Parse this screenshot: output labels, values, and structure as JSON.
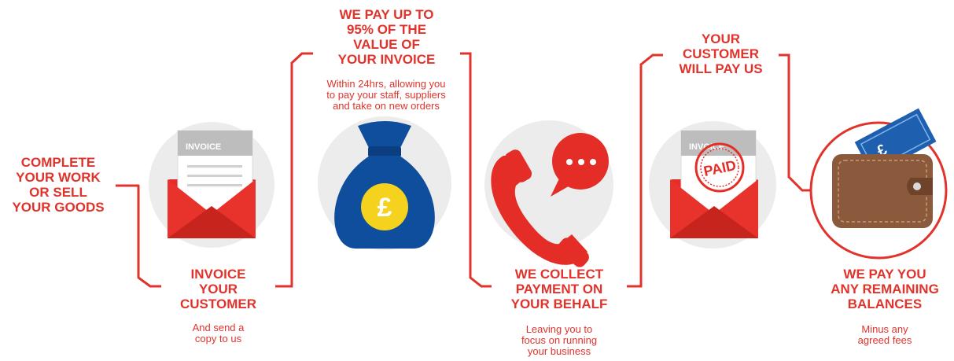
{
  "colors": {
    "brand_red": "#e0332c",
    "circle_grey": "#ececec",
    "bag_blue": "#0f4e9c",
    "coin_yellow": "#f5d21e",
    "wallet_brown": "#8b5a3c",
    "note_blue": "#1f5fb0"
  },
  "steps": [
    {
      "id": "complete-work",
      "heading": [
        "COMPLETE",
        "YOUR WORK",
        "OR SELL",
        "YOUR GOODS"
      ],
      "subtext": []
    },
    {
      "id": "invoice-customer",
      "heading": [
        "INVOICE",
        "YOUR",
        "CUSTOMER"
      ],
      "subtext": [
        "And send a",
        "copy to us"
      ],
      "icon": "envelope-invoice-icon",
      "icon_label": "INVOICE"
    },
    {
      "id": "we-pay",
      "heading": [
        "WE PAY UP TO",
        "95% OF THE",
        "VALUE OF",
        "YOUR INVOICE"
      ],
      "subtext": [
        "Within 24hrs, allowing you",
        "to pay your staff, suppliers",
        "and take on new orders"
      ],
      "icon": "money-bag-icon",
      "icon_label": "£"
    },
    {
      "id": "collect-payment",
      "heading": [
        "WE COLLECT",
        "PAYMENT ON",
        "YOUR BEHALF"
      ],
      "subtext": [
        "Leaving you to",
        "focus on running",
        "your business"
      ],
      "icon": "phone-call-icon"
    },
    {
      "id": "customer-pays",
      "heading": [
        "YOUR",
        "CUSTOMER",
        "WILL PAY US"
      ],
      "subtext": [],
      "icon": "envelope-paid-icon",
      "icon_label": "INVOICE",
      "stamp_label": "PAID"
    },
    {
      "id": "pay-balances",
      "heading": [
        "WE PAY YOU",
        "ANY REMAINING",
        "BALANCES"
      ],
      "subtext": [
        "Minus any",
        "agreed fees"
      ],
      "icon": "wallet-icon",
      "note_label": "£"
    }
  ]
}
